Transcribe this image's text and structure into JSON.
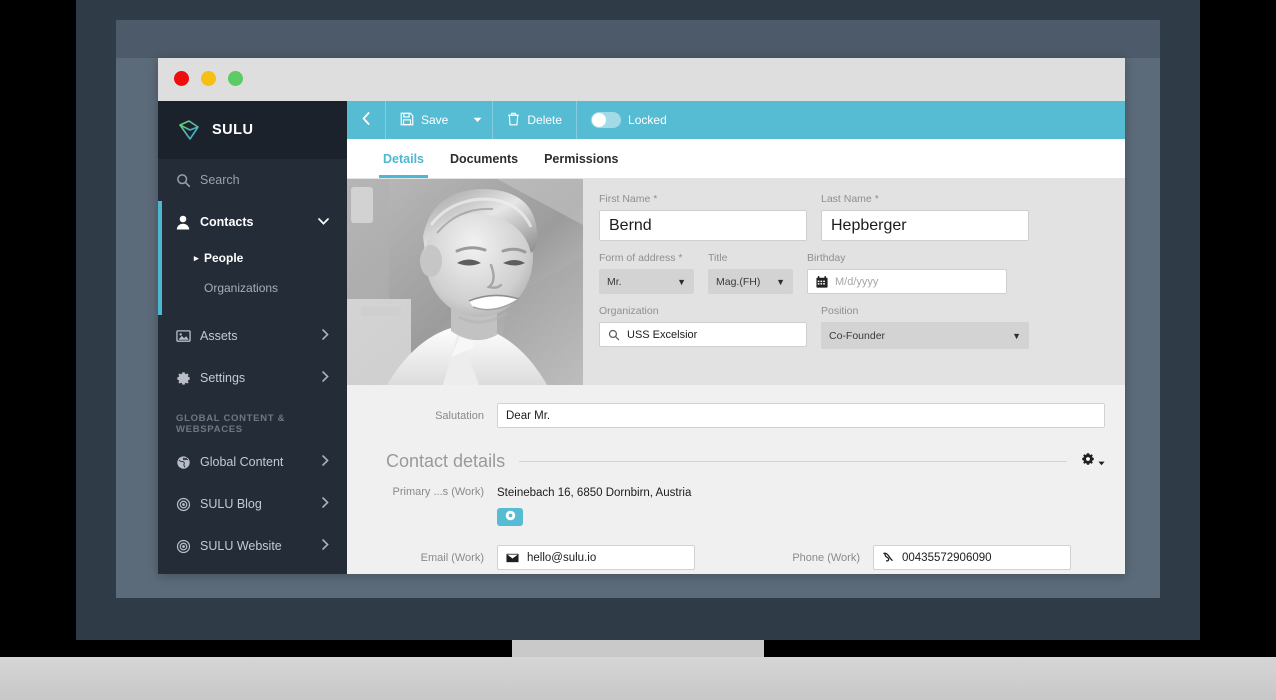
{
  "sidebar": {
    "brand": "SULU",
    "search": {
      "label": "Search",
      "icon": "search-icon"
    },
    "contacts": {
      "label": "Contacts",
      "icon": "person-icon",
      "chevron": "chevron-down-icon",
      "children": [
        {
          "label": "People",
          "selected": true
        },
        {
          "label": "Organizations",
          "selected": false
        }
      ]
    },
    "items": [
      {
        "label": "Assets",
        "icon": "image-icon",
        "chevron": "chevron-right-icon"
      },
      {
        "label": "Settings",
        "icon": "gear-icon",
        "chevron": "chevron-right-icon"
      }
    ],
    "section_heading": "GLOBAL CONTENT & WEBSPACES",
    "section_items": [
      {
        "label": "Global Content",
        "icon": "globe-icon",
        "chevron": "chevron-right-icon"
      },
      {
        "label": "SULU Blog",
        "icon": "target-icon",
        "chevron": "chevron-right-icon"
      },
      {
        "label": "SULU Website",
        "icon": "target-icon",
        "chevron": "chevron-right-icon"
      }
    ]
  },
  "toolbar": {
    "back": "back-arrow-icon",
    "save_label": "Save",
    "save_icon": "floppy-disk-icon",
    "save_caret": "caret-down-icon",
    "delete_label": "Delete",
    "delete_icon": "trash-icon",
    "locked_label": "Locked",
    "locked_state": "off"
  },
  "tabs": [
    {
      "label": "Details",
      "active": true
    },
    {
      "label": "Documents",
      "active": false
    },
    {
      "label": "Permissions",
      "active": false
    }
  ],
  "form": {
    "first_name": {
      "label": "First Name *",
      "value": "Bernd"
    },
    "last_name": {
      "label": "Last Name *",
      "value": "Hepberger"
    },
    "form_of_address": {
      "label": "Form of address *",
      "value": "Mr."
    },
    "title": {
      "label": "Title",
      "value": "Mag.(FH)"
    },
    "birthday": {
      "label": "Birthday",
      "value": "",
      "placeholder": "M/d/yyyy",
      "icon": "calendar-icon"
    },
    "organization": {
      "label": "Organization",
      "value": "USS Excelsior",
      "icon": "search-icon"
    },
    "position": {
      "label": "Position",
      "value": "Co-Founder"
    },
    "salutation": {
      "label": "Salutation",
      "value": "Dear Mr."
    }
  },
  "contact_details": {
    "heading": "Contact details",
    "gear_icon": "gear-icon",
    "gear_caret": "caret-down-icon",
    "address": {
      "label": "Primary ...s (Work)",
      "value": "Steinebach 16, 6850 Dornbirn, Austria"
    },
    "add_button_icon": "add-circle-icon",
    "email": {
      "label": "Email (Work)",
      "value": "hello@sulu.io",
      "icon": "envelope-icon"
    },
    "phone": {
      "label": "Phone (Work)",
      "value": "00435572906090",
      "icon": "phone-icon"
    }
  },
  "window": {
    "dots": [
      "close-red",
      "minimize-yellow",
      "maximize-green"
    ]
  },
  "colors": {
    "accent": "#4cb8d1",
    "toolbar": "#56bcd3",
    "sidebar": "#242c38",
    "sidebar_brand": "#1c222c",
    "frame": "#2f3c47",
    "screen_bezel": "#5c6b7a"
  }
}
